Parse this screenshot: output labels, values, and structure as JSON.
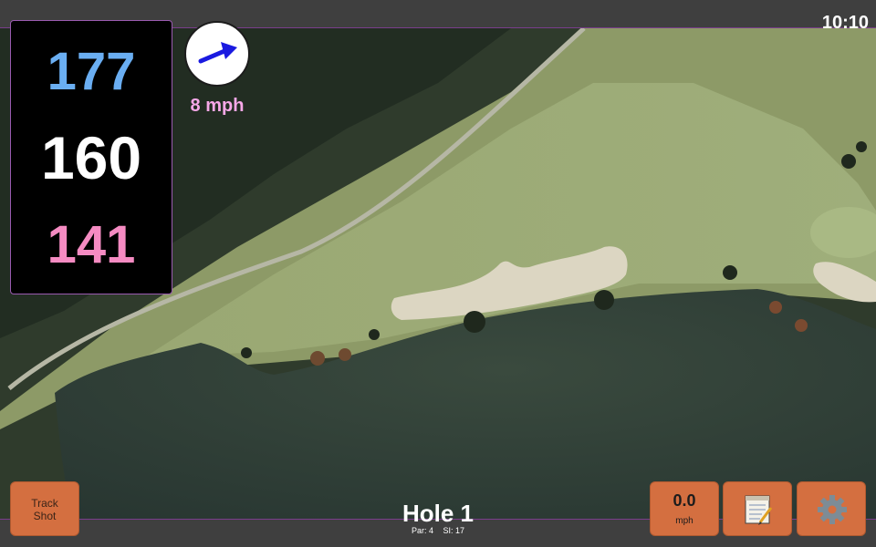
{
  "status": {
    "clock": "10:10"
  },
  "distances": {
    "back": "177",
    "middle": "160",
    "front": "141"
  },
  "wind": {
    "speed_label": "8 mph",
    "arrow_icon": "wind-arrow-icon"
  },
  "hole": {
    "title": "Hole 1",
    "par_label": "Par: 4",
    "si_label": "SI: 17"
  },
  "buttons": {
    "track_shot_line1": "Track",
    "track_shot_line2": "Shot",
    "speed_value": "0.0",
    "speed_unit": "mph",
    "notes_icon": "notepad-icon",
    "settings_icon": "gear-icon"
  },
  "colors": {
    "accent_purple": "#7a3d8c",
    "button_orange": "#d46f40",
    "back_distance": "#6aaef2",
    "front_distance": "#f58bc2",
    "wind_label": "#f7a8e8"
  }
}
